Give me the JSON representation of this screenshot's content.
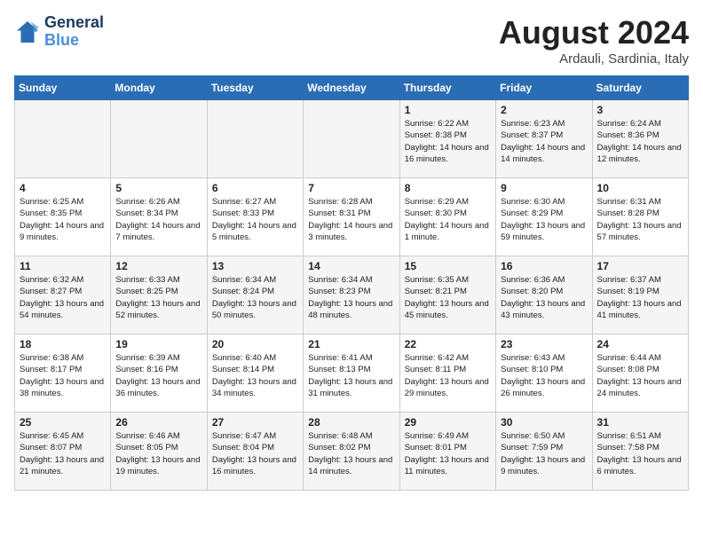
{
  "logo": {
    "line1": "General",
    "line2": "Blue"
  },
  "title": "August 2024",
  "subtitle": "Ardauli, Sardinia, Italy",
  "weekdays": [
    "Sunday",
    "Monday",
    "Tuesday",
    "Wednesday",
    "Thursday",
    "Friday",
    "Saturday"
  ],
  "weeks": [
    [
      {
        "day": "",
        "info": ""
      },
      {
        "day": "",
        "info": ""
      },
      {
        "day": "",
        "info": ""
      },
      {
        "day": "",
        "info": ""
      },
      {
        "day": "1",
        "info": "Sunrise: 6:22 AM\nSunset: 8:38 PM\nDaylight: 14 hours and 16 minutes."
      },
      {
        "day": "2",
        "info": "Sunrise: 6:23 AM\nSunset: 8:37 PM\nDaylight: 14 hours and 14 minutes."
      },
      {
        "day": "3",
        "info": "Sunrise: 6:24 AM\nSunset: 8:36 PM\nDaylight: 14 hours and 12 minutes."
      }
    ],
    [
      {
        "day": "4",
        "info": "Sunrise: 6:25 AM\nSunset: 8:35 PM\nDaylight: 14 hours and 9 minutes."
      },
      {
        "day": "5",
        "info": "Sunrise: 6:26 AM\nSunset: 8:34 PM\nDaylight: 14 hours and 7 minutes."
      },
      {
        "day": "6",
        "info": "Sunrise: 6:27 AM\nSunset: 8:33 PM\nDaylight: 14 hours and 5 minutes."
      },
      {
        "day": "7",
        "info": "Sunrise: 6:28 AM\nSunset: 8:31 PM\nDaylight: 14 hours and 3 minutes."
      },
      {
        "day": "8",
        "info": "Sunrise: 6:29 AM\nSunset: 8:30 PM\nDaylight: 14 hours and 1 minute."
      },
      {
        "day": "9",
        "info": "Sunrise: 6:30 AM\nSunset: 8:29 PM\nDaylight: 13 hours and 59 minutes."
      },
      {
        "day": "10",
        "info": "Sunrise: 6:31 AM\nSunset: 8:28 PM\nDaylight: 13 hours and 57 minutes."
      }
    ],
    [
      {
        "day": "11",
        "info": "Sunrise: 6:32 AM\nSunset: 8:27 PM\nDaylight: 13 hours and 54 minutes."
      },
      {
        "day": "12",
        "info": "Sunrise: 6:33 AM\nSunset: 8:25 PM\nDaylight: 13 hours and 52 minutes."
      },
      {
        "day": "13",
        "info": "Sunrise: 6:34 AM\nSunset: 8:24 PM\nDaylight: 13 hours and 50 minutes."
      },
      {
        "day": "14",
        "info": "Sunrise: 6:34 AM\nSunset: 8:23 PM\nDaylight: 13 hours and 48 minutes."
      },
      {
        "day": "15",
        "info": "Sunrise: 6:35 AM\nSunset: 8:21 PM\nDaylight: 13 hours and 45 minutes."
      },
      {
        "day": "16",
        "info": "Sunrise: 6:36 AM\nSunset: 8:20 PM\nDaylight: 13 hours and 43 minutes."
      },
      {
        "day": "17",
        "info": "Sunrise: 6:37 AM\nSunset: 8:19 PM\nDaylight: 13 hours and 41 minutes."
      }
    ],
    [
      {
        "day": "18",
        "info": "Sunrise: 6:38 AM\nSunset: 8:17 PM\nDaylight: 13 hours and 38 minutes."
      },
      {
        "day": "19",
        "info": "Sunrise: 6:39 AM\nSunset: 8:16 PM\nDaylight: 13 hours and 36 minutes."
      },
      {
        "day": "20",
        "info": "Sunrise: 6:40 AM\nSunset: 8:14 PM\nDaylight: 13 hours and 34 minutes."
      },
      {
        "day": "21",
        "info": "Sunrise: 6:41 AM\nSunset: 8:13 PM\nDaylight: 13 hours and 31 minutes."
      },
      {
        "day": "22",
        "info": "Sunrise: 6:42 AM\nSunset: 8:11 PM\nDaylight: 13 hours and 29 minutes."
      },
      {
        "day": "23",
        "info": "Sunrise: 6:43 AM\nSunset: 8:10 PM\nDaylight: 13 hours and 26 minutes."
      },
      {
        "day": "24",
        "info": "Sunrise: 6:44 AM\nSunset: 8:08 PM\nDaylight: 13 hours and 24 minutes."
      }
    ],
    [
      {
        "day": "25",
        "info": "Sunrise: 6:45 AM\nSunset: 8:07 PM\nDaylight: 13 hours and 21 minutes."
      },
      {
        "day": "26",
        "info": "Sunrise: 6:46 AM\nSunset: 8:05 PM\nDaylight: 13 hours and 19 minutes."
      },
      {
        "day": "27",
        "info": "Sunrise: 6:47 AM\nSunset: 8:04 PM\nDaylight: 13 hours and 16 minutes."
      },
      {
        "day": "28",
        "info": "Sunrise: 6:48 AM\nSunset: 8:02 PM\nDaylight: 13 hours and 14 minutes."
      },
      {
        "day": "29",
        "info": "Sunrise: 6:49 AM\nSunset: 8:01 PM\nDaylight: 13 hours and 11 minutes."
      },
      {
        "day": "30",
        "info": "Sunrise: 6:50 AM\nSunset: 7:59 PM\nDaylight: 13 hours and 9 minutes."
      },
      {
        "day": "31",
        "info": "Sunrise: 6:51 AM\nSunset: 7:58 PM\nDaylight: 13 hours and 6 minutes."
      }
    ]
  ]
}
